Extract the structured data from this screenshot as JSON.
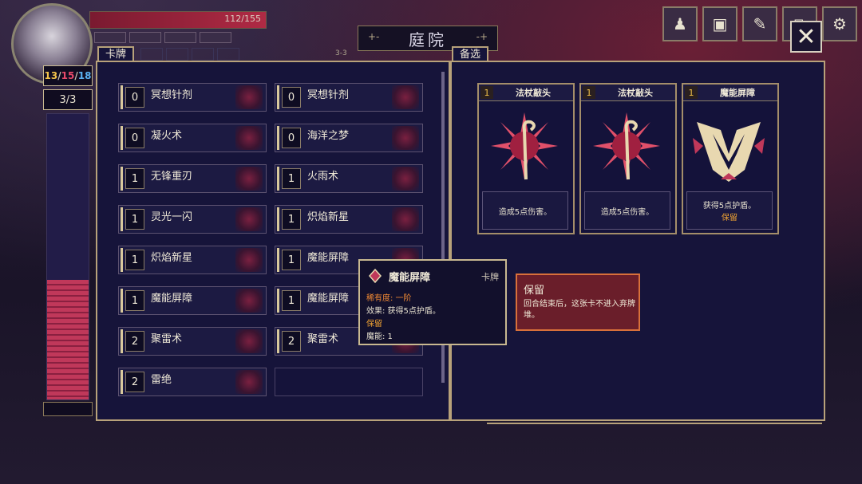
{
  "header": {
    "hp_text": "112/155",
    "title": "庭院",
    "title_dec_left": "+-",
    "title_dec_right": "-+",
    "page_indicator": "3-3"
  },
  "top_icons": [
    {
      "name": "character-icon",
      "glyph": "♟"
    },
    {
      "name": "backpack-icon",
      "glyph": "▣"
    },
    {
      "name": "notebook-icon",
      "glyph": "✎"
    },
    {
      "name": "map-icon",
      "glyph": "⧉"
    },
    {
      "name": "gear-icon",
      "glyph": "⚙"
    }
  ],
  "close_glyph": "✕",
  "left": {
    "counter_a": "13",
    "counter_b": "15",
    "counter_c": "18",
    "sep": "/",
    "counter2": "3/3",
    "energy_level": 0.42
  },
  "tabs": {
    "deck": "卡牌",
    "pick": "备选"
  },
  "deck": [
    {
      "cost": "0",
      "name": "冥想针剂"
    },
    {
      "cost": "0",
      "name": "冥想针剂"
    },
    {
      "cost": "0",
      "name": "凝火术"
    },
    {
      "cost": "0",
      "name": "海洋之梦"
    },
    {
      "cost": "1",
      "name": "无锋重刃"
    },
    {
      "cost": "1",
      "name": "火雨术"
    },
    {
      "cost": "1",
      "name": "灵光一闪"
    },
    {
      "cost": "1",
      "name": "炽焰新星"
    },
    {
      "cost": "1",
      "name": "炽焰新星"
    },
    {
      "cost": "1",
      "name": "魔能屏障"
    },
    {
      "cost": "1",
      "name": "魔能屏障"
    },
    {
      "cost": "1",
      "name": "魔能屏障"
    },
    {
      "cost": "2",
      "name": "聚雷术"
    },
    {
      "cost": "2",
      "name": "聚雷术"
    },
    {
      "cost": "2",
      "name": "雷绝"
    }
  ],
  "picks": [
    {
      "cost": "1",
      "title": "法杖敲头",
      "desc": "造成5点伤害。",
      "keep": ""
    },
    {
      "cost": "1",
      "title": "法杖敲头",
      "desc": "造成5点伤害。",
      "keep": ""
    },
    {
      "cost": "1",
      "title": "魔能屏障",
      "desc": "获得5点护盾。",
      "keep": "保留"
    }
  ],
  "tooltip": {
    "title": "魔能屏障",
    "type": "卡牌",
    "rarity": "稀有度: 一阶",
    "effect": "效果: 获得5点护盾。",
    "keep": "保留",
    "energy": "魔能: 1"
  },
  "keep_info": {
    "title": "保留",
    "desc": "回合结束后，这张卡不进入弃牌堆。"
  },
  "colors": {
    "gold": "#b8a27a",
    "panel": "#16143a",
    "accent_red": "#c0385a",
    "orange": "#f2a432"
  }
}
